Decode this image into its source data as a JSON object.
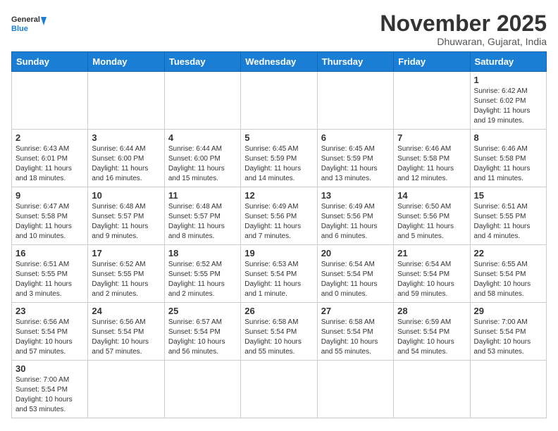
{
  "header": {
    "logo_general": "General",
    "logo_blue": "Blue",
    "month_title": "November 2025",
    "location": "Dhuwaran, Gujarat, India"
  },
  "weekdays": [
    "Sunday",
    "Monday",
    "Tuesday",
    "Wednesday",
    "Thursday",
    "Friday",
    "Saturday"
  ],
  "weeks": [
    [
      {
        "day": "",
        "info": ""
      },
      {
        "day": "",
        "info": ""
      },
      {
        "day": "",
        "info": ""
      },
      {
        "day": "",
        "info": ""
      },
      {
        "day": "",
        "info": ""
      },
      {
        "day": "",
        "info": ""
      },
      {
        "day": "1",
        "info": "Sunrise: 6:42 AM\nSunset: 6:02 PM\nDaylight: 11 hours\nand 19 minutes."
      }
    ],
    [
      {
        "day": "2",
        "info": "Sunrise: 6:43 AM\nSunset: 6:01 PM\nDaylight: 11 hours\nand 18 minutes."
      },
      {
        "day": "3",
        "info": "Sunrise: 6:44 AM\nSunset: 6:00 PM\nDaylight: 11 hours\nand 16 minutes."
      },
      {
        "day": "4",
        "info": "Sunrise: 6:44 AM\nSunset: 6:00 PM\nDaylight: 11 hours\nand 15 minutes."
      },
      {
        "day": "5",
        "info": "Sunrise: 6:45 AM\nSunset: 5:59 PM\nDaylight: 11 hours\nand 14 minutes."
      },
      {
        "day": "6",
        "info": "Sunrise: 6:45 AM\nSunset: 5:59 PM\nDaylight: 11 hours\nand 13 minutes."
      },
      {
        "day": "7",
        "info": "Sunrise: 6:46 AM\nSunset: 5:58 PM\nDaylight: 11 hours\nand 12 minutes."
      },
      {
        "day": "8",
        "info": "Sunrise: 6:46 AM\nSunset: 5:58 PM\nDaylight: 11 hours\nand 11 minutes."
      }
    ],
    [
      {
        "day": "9",
        "info": "Sunrise: 6:47 AM\nSunset: 5:58 PM\nDaylight: 11 hours\nand 10 minutes."
      },
      {
        "day": "10",
        "info": "Sunrise: 6:48 AM\nSunset: 5:57 PM\nDaylight: 11 hours\nand 9 minutes."
      },
      {
        "day": "11",
        "info": "Sunrise: 6:48 AM\nSunset: 5:57 PM\nDaylight: 11 hours\nand 8 minutes."
      },
      {
        "day": "12",
        "info": "Sunrise: 6:49 AM\nSunset: 5:56 PM\nDaylight: 11 hours\nand 7 minutes."
      },
      {
        "day": "13",
        "info": "Sunrise: 6:49 AM\nSunset: 5:56 PM\nDaylight: 11 hours\nand 6 minutes."
      },
      {
        "day": "14",
        "info": "Sunrise: 6:50 AM\nSunset: 5:56 PM\nDaylight: 11 hours\nand 5 minutes."
      },
      {
        "day": "15",
        "info": "Sunrise: 6:51 AM\nSunset: 5:55 PM\nDaylight: 11 hours\nand 4 minutes."
      }
    ],
    [
      {
        "day": "16",
        "info": "Sunrise: 6:51 AM\nSunset: 5:55 PM\nDaylight: 11 hours\nand 3 minutes."
      },
      {
        "day": "17",
        "info": "Sunrise: 6:52 AM\nSunset: 5:55 PM\nDaylight: 11 hours\nand 2 minutes."
      },
      {
        "day": "18",
        "info": "Sunrise: 6:52 AM\nSunset: 5:55 PM\nDaylight: 11 hours\nand 2 minutes."
      },
      {
        "day": "19",
        "info": "Sunrise: 6:53 AM\nSunset: 5:54 PM\nDaylight: 11 hours\nand 1 minute."
      },
      {
        "day": "20",
        "info": "Sunrise: 6:54 AM\nSunset: 5:54 PM\nDaylight: 11 hours\nand 0 minutes."
      },
      {
        "day": "21",
        "info": "Sunrise: 6:54 AM\nSunset: 5:54 PM\nDaylight: 10 hours\nand 59 minutes."
      },
      {
        "day": "22",
        "info": "Sunrise: 6:55 AM\nSunset: 5:54 PM\nDaylight: 10 hours\nand 58 minutes."
      }
    ],
    [
      {
        "day": "23",
        "info": "Sunrise: 6:56 AM\nSunset: 5:54 PM\nDaylight: 10 hours\nand 57 minutes."
      },
      {
        "day": "24",
        "info": "Sunrise: 6:56 AM\nSunset: 5:54 PM\nDaylight: 10 hours\nand 57 minutes."
      },
      {
        "day": "25",
        "info": "Sunrise: 6:57 AM\nSunset: 5:54 PM\nDaylight: 10 hours\nand 56 minutes."
      },
      {
        "day": "26",
        "info": "Sunrise: 6:58 AM\nSunset: 5:54 PM\nDaylight: 10 hours\nand 55 minutes."
      },
      {
        "day": "27",
        "info": "Sunrise: 6:58 AM\nSunset: 5:54 PM\nDaylight: 10 hours\nand 55 minutes."
      },
      {
        "day": "28",
        "info": "Sunrise: 6:59 AM\nSunset: 5:54 PM\nDaylight: 10 hours\nand 54 minutes."
      },
      {
        "day": "29",
        "info": "Sunrise: 7:00 AM\nSunset: 5:54 PM\nDaylight: 10 hours\nand 53 minutes."
      }
    ],
    [
      {
        "day": "30",
        "info": "Sunrise: 7:00 AM\nSunset: 5:54 PM\nDaylight: 10 hours\nand 53 minutes."
      },
      {
        "day": "",
        "info": ""
      },
      {
        "day": "",
        "info": ""
      },
      {
        "day": "",
        "info": ""
      },
      {
        "day": "",
        "info": ""
      },
      {
        "day": "",
        "info": ""
      },
      {
        "day": "",
        "info": ""
      }
    ]
  ]
}
